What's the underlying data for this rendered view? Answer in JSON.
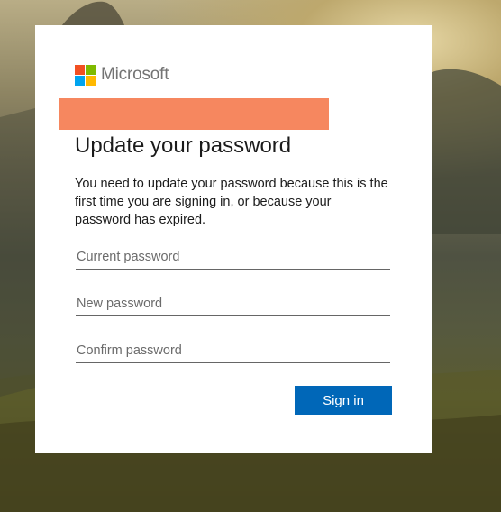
{
  "brand": {
    "name": "Microsoft",
    "logo_colors": [
      "#f25022",
      "#7fba00",
      "#00a4ef",
      "#ffb900"
    ]
  },
  "redaction_color": "#f6875f",
  "title": "Update your password",
  "description": "You need to update your password because this is the first time you are signing in, or because your password has expired.",
  "fields": {
    "current_password": {
      "placeholder": "Current password",
      "value": ""
    },
    "new_password": {
      "placeholder": "New password",
      "value": ""
    },
    "confirm_password": {
      "placeholder": "Confirm password",
      "value": ""
    }
  },
  "signin_button": {
    "label": "Sign in",
    "color": "#0067b8"
  }
}
